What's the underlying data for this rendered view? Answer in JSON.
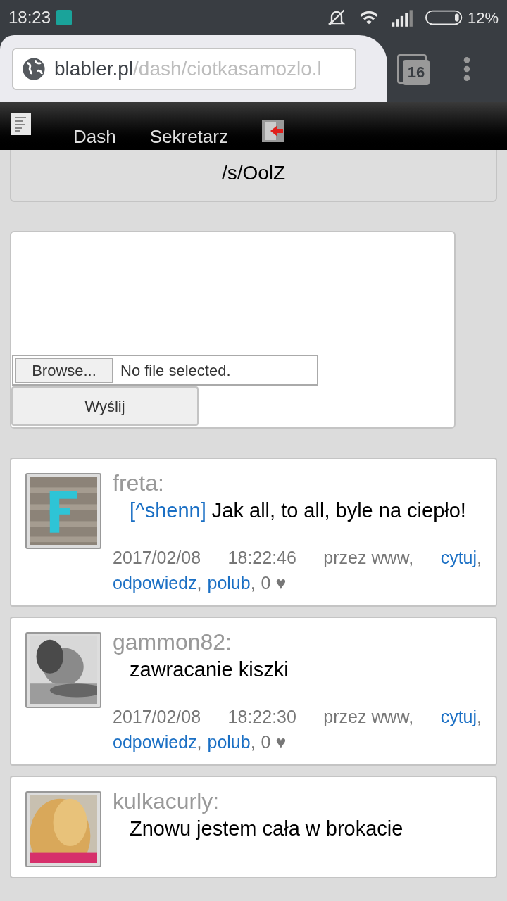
{
  "status_bar": {
    "time": "18:23",
    "battery": "12%"
  },
  "browser": {
    "url_host": "blabler.pl",
    "url_path": "/dash/ciotkasamozlo.l",
    "tab_count": "16"
  },
  "nav": {
    "items": [
      {
        "label": "Dash"
      },
      {
        "label": "Sekretarz"
      }
    ]
  },
  "status_message": {
    "text": "/s/OolZ"
  },
  "upload": {
    "browse_button": "Browse...",
    "file_status": "No file selected.",
    "submit_button": "Wyślij"
  },
  "posts": [
    {
      "author": "freta:",
      "mention": "[^shenn]",
      "text": "Jak all, to all, byle na ciepło!",
      "date": "2017/02/08",
      "time": "18:22:46",
      "via": "przez www,",
      "quote": "cytuj",
      "reply": "odpowiedz",
      "like": "polub",
      "separator": ",",
      "likes": "0 ♥"
    },
    {
      "author": "gammon82:",
      "text": "zawracanie kiszki",
      "date": "2017/02/08",
      "time": "18:22:30",
      "via": "przez www,",
      "quote": "cytuj",
      "reply": "odpowiedz",
      "like": "polub",
      "separator": ",",
      "likes": "0 ♥"
    },
    {
      "author": "kulkacurly:",
      "text": "Znowu jestem cała w brokacie"
    }
  ]
}
